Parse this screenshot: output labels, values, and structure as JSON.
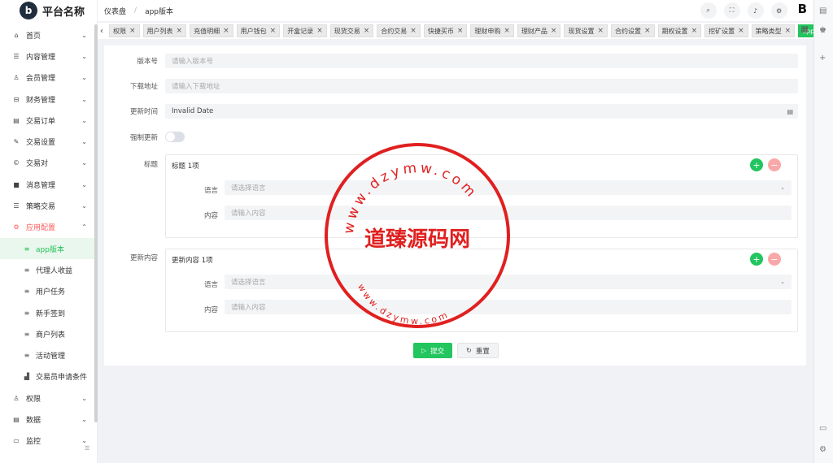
{
  "app": {
    "logo_letter": "b",
    "title": "平台名称"
  },
  "breadcrumb": [
    "仪表盘",
    "app版本"
  ],
  "header_icons": [
    "search-icon",
    "fullscreen-icon",
    "bell-icon",
    "settings-icon"
  ],
  "brand_mark": "B",
  "sidebar": {
    "items": [
      {
        "label": "首页",
        "icon": "⌂"
      },
      {
        "label": "内容管理",
        "icon": "☰"
      },
      {
        "label": "会员管理",
        "icon": "♙"
      },
      {
        "label": "财务管理",
        "icon": "⊟"
      },
      {
        "label": "交易订单",
        "icon": "▤"
      },
      {
        "label": "交易设置",
        "icon": "✎"
      },
      {
        "label": "交易对",
        "icon": "©"
      },
      {
        "label": "消息管理",
        "icon": "■"
      },
      {
        "label": "策略交易",
        "icon": "☰"
      },
      {
        "label": "应用配置",
        "icon": "⚙"
      }
    ],
    "sub_items": [
      {
        "label": "app版本"
      },
      {
        "label": "代理人收益"
      },
      {
        "label": "用户任务"
      },
      {
        "label": "新手签到"
      },
      {
        "label": "商户列表"
      },
      {
        "label": "活动管理"
      },
      {
        "label": "交易员申请条件"
      }
    ],
    "bottom_items": [
      {
        "label": "权限",
        "icon": "♙"
      },
      {
        "label": "数据",
        "icon": "▤"
      },
      {
        "label": "监控",
        "icon": "▭"
      }
    ]
  },
  "tabs": [
    "权限",
    "用户列表",
    "充值明细",
    "用户钱包",
    "开盒记录",
    "现货交易",
    "合约交易",
    "快捷买币",
    "理财申购",
    "理财产品",
    "现货设置",
    "合约设置",
    "期权设置",
    "挖矿设置",
    "策略类型",
    "app版本"
  ],
  "form": {
    "version_label": "版本号",
    "version_placeholder": "请输入版本号",
    "download_label": "下载地址",
    "download_placeholder": "请输入下载地址",
    "update_time_label": "更新时间",
    "update_time_value": "Invalid Date",
    "force_update_label": "强制更新",
    "title_label": "标题",
    "title_group_head": "标题 1项",
    "update_content_label": "更新内容",
    "update_group_head": "更新内容 1项",
    "lang_label": "语言",
    "lang_placeholder": "请选择语言",
    "content_label": "内容",
    "content_placeholder": "请输入内容"
  },
  "actions": {
    "submit": "提交",
    "reset": "重置"
  },
  "watermark": {
    "text": "道臻源码网",
    "ring_text": "www.dzymw.com"
  }
}
